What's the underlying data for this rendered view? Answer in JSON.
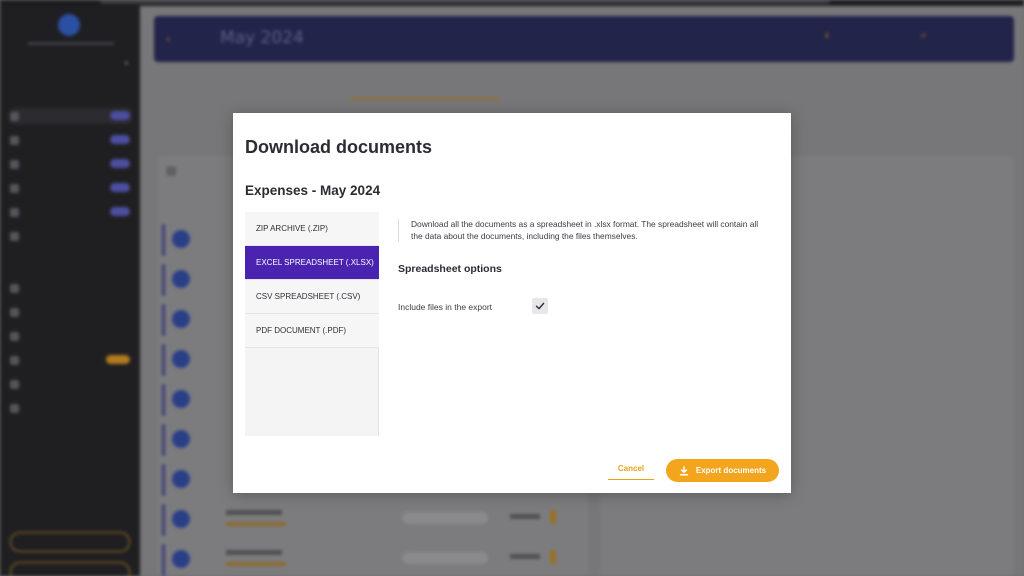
{
  "modal": {
    "title": "Download documents",
    "subtitle": "Expenses - May 2024",
    "formats": [
      {
        "label": "ZIP ARCHIVE (.ZIP)",
        "selected": false
      },
      {
        "label": "EXCEL SPREADSHEET (.XLSX)",
        "selected": true
      },
      {
        "label": "CSV SPREADSHEET (.CSV)",
        "selected": false
      },
      {
        "label": "PDF DOCUMENT (.PDF)",
        "selected": false
      }
    ],
    "description": "Download all the documents as a spreadsheet in .xlsx format. The spreadsheet will contain all the data about the documents, including the files themselves.",
    "options_title": "Spreadsheet options",
    "include_files_label": "Include files in the export",
    "include_files_checked": true,
    "cancel_label": "Cancel",
    "export_label": "Export documents"
  },
  "background": {
    "header_title": "May 2024"
  },
  "colors": {
    "accent_purple": "#4a24b0",
    "accent_orange": "#f2a51d",
    "sidebar_bg": "#1f1f22"
  },
  "icons": {
    "check": "check-icon",
    "download": "download-icon"
  }
}
